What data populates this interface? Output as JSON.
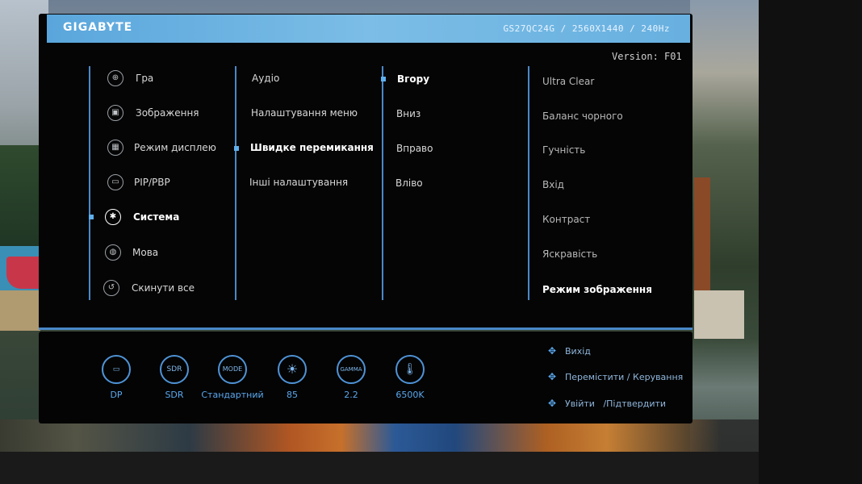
{
  "header": {
    "brand": "GIGABYTE",
    "model": "GS27QC24G / 2560X1440 / 240Hz",
    "version": "Version: F01"
  },
  "menu": {
    "main": [
      {
        "label": "Гра",
        "icon": "gamepad-icon",
        "selected": false
      },
      {
        "label": "Зображення",
        "icon": "image-icon",
        "selected": false
      },
      {
        "label": "Режим дисплею",
        "icon": "display-mode-icon",
        "selected": false
      },
      {
        "label": "PIP/PBP",
        "icon": "pip-icon",
        "selected": false
      },
      {
        "label": "Система",
        "icon": "gear-icon",
        "selected": true
      },
      {
        "label": "Мова",
        "icon": "globe-icon",
        "selected": false
      },
      {
        "label": "Скинути все",
        "icon": "reset-icon",
        "selected": false
      }
    ],
    "sub": [
      {
        "label": "Аудіо",
        "selected": false
      },
      {
        "label": "Налаштування меню",
        "selected": false
      },
      {
        "label": "Швидке перемикання",
        "selected": true
      },
      {
        "label": "Інші налаштування",
        "selected": false
      }
    ],
    "options": [
      {
        "label": "Вгору",
        "selected": true
      },
      {
        "label": "Вниз",
        "selected": false
      },
      {
        "label": "Вправо",
        "selected": false
      },
      {
        "label": "Вліво",
        "selected": false
      }
    ],
    "values": [
      {
        "label": "Ultra Clear",
        "selected": false
      },
      {
        "label": "Баланс чорного",
        "selected": false
      },
      {
        "label": "Гучність",
        "selected": false
      },
      {
        "label": "Вхід",
        "selected": false
      },
      {
        "label": "Контраст",
        "selected": false
      },
      {
        "label": "Яскравість",
        "selected": false
      },
      {
        "label": "Режим зображення",
        "selected": true
      }
    ]
  },
  "status": [
    {
      "icon_text": "▭",
      "value": "DP",
      "icon": "dp-input-icon"
    },
    {
      "icon_text": "SDR",
      "value": "SDR",
      "icon": "sdr-icon"
    },
    {
      "icon_text": "MODE",
      "value": "Стандартний",
      "icon": "mode-icon"
    },
    {
      "icon_text": "☀",
      "value": "85",
      "icon": "brightness-icon"
    },
    {
      "icon_text": "GAMMA",
      "value": "2.2",
      "icon": "gamma-icon"
    },
    {
      "icon_text": "🌡",
      "value": "6500K",
      "icon": "color-temp-icon"
    }
  ],
  "nav": [
    {
      "label": "Вихід",
      "icon": "joystick-left-icon"
    },
    {
      "label": "Перемістити / Керування",
      "icon": "joystick-updown-icon"
    },
    {
      "label": "Увійти   /Підтвердити",
      "icon": "joystick-press-icon"
    }
  ],
  "colors": {
    "accent": "#5aa8ee",
    "header": "#68b0e0",
    "panel": "#050505"
  }
}
